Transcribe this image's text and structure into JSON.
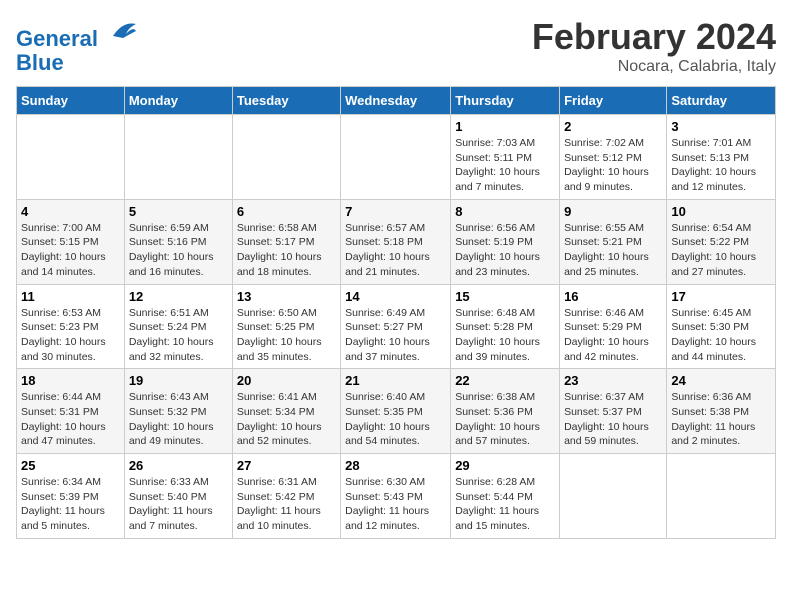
{
  "header": {
    "logo_line1": "General",
    "logo_line2": "Blue",
    "title": "February 2024",
    "subtitle": "Nocara, Calabria, Italy"
  },
  "days_of_week": [
    "Sunday",
    "Monday",
    "Tuesday",
    "Wednesday",
    "Thursday",
    "Friday",
    "Saturday"
  ],
  "weeks": [
    [
      {
        "num": "",
        "info": ""
      },
      {
        "num": "",
        "info": ""
      },
      {
        "num": "",
        "info": ""
      },
      {
        "num": "",
        "info": ""
      },
      {
        "num": "1",
        "info": "Sunrise: 7:03 AM\nSunset: 5:11 PM\nDaylight: 10 hours and 7 minutes."
      },
      {
        "num": "2",
        "info": "Sunrise: 7:02 AM\nSunset: 5:12 PM\nDaylight: 10 hours and 9 minutes."
      },
      {
        "num": "3",
        "info": "Sunrise: 7:01 AM\nSunset: 5:13 PM\nDaylight: 10 hours and 12 minutes."
      }
    ],
    [
      {
        "num": "4",
        "info": "Sunrise: 7:00 AM\nSunset: 5:15 PM\nDaylight: 10 hours and 14 minutes."
      },
      {
        "num": "5",
        "info": "Sunrise: 6:59 AM\nSunset: 5:16 PM\nDaylight: 10 hours and 16 minutes."
      },
      {
        "num": "6",
        "info": "Sunrise: 6:58 AM\nSunset: 5:17 PM\nDaylight: 10 hours and 18 minutes."
      },
      {
        "num": "7",
        "info": "Sunrise: 6:57 AM\nSunset: 5:18 PM\nDaylight: 10 hours and 21 minutes."
      },
      {
        "num": "8",
        "info": "Sunrise: 6:56 AM\nSunset: 5:19 PM\nDaylight: 10 hours and 23 minutes."
      },
      {
        "num": "9",
        "info": "Sunrise: 6:55 AM\nSunset: 5:21 PM\nDaylight: 10 hours and 25 minutes."
      },
      {
        "num": "10",
        "info": "Sunrise: 6:54 AM\nSunset: 5:22 PM\nDaylight: 10 hours and 27 minutes."
      }
    ],
    [
      {
        "num": "11",
        "info": "Sunrise: 6:53 AM\nSunset: 5:23 PM\nDaylight: 10 hours and 30 minutes."
      },
      {
        "num": "12",
        "info": "Sunrise: 6:51 AM\nSunset: 5:24 PM\nDaylight: 10 hours and 32 minutes."
      },
      {
        "num": "13",
        "info": "Sunrise: 6:50 AM\nSunset: 5:25 PM\nDaylight: 10 hours and 35 minutes."
      },
      {
        "num": "14",
        "info": "Sunrise: 6:49 AM\nSunset: 5:27 PM\nDaylight: 10 hours and 37 minutes."
      },
      {
        "num": "15",
        "info": "Sunrise: 6:48 AM\nSunset: 5:28 PM\nDaylight: 10 hours and 39 minutes."
      },
      {
        "num": "16",
        "info": "Sunrise: 6:46 AM\nSunset: 5:29 PM\nDaylight: 10 hours and 42 minutes."
      },
      {
        "num": "17",
        "info": "Sunrise: 6:45 AM\nSunset: 5:30 PM\nDaylight: 10 hours and 44 minutes."
      }
    ],
    [
      {
        "num": "18",
        "info": "Sunrise: 6:44 AM\nSunset: 5:31 PM\nDaylight: 10 hours and 47 minutes."
      },
      {
        "num": "19",
        "info": "Sunrise: 6:43 AM\nSunset: 5:32 PM\nDaylight: 10 hours and 49 minutes."
      },
      {
        "num": "20",
        "info": "Sunrise: 6:41 AM\nSunset: 5:34 PM\nDaylight: 10 hours and 52 minutes."
      },
      {
        "num": "21",
        "info": "Sunrise: 6:40 AM\nSunset: 5:35 PM\nDaylight: 10 hours and 54 minutes."
      },
      {
        "num": "22",
        "info": "Sunrise: 6:38 AM\nSunset: 5:36 PM\nDaylight: 10 hours and 57 minutes."
      },
      {
        "num": "23",
        "info": "Sunrise: 6:37 AM\nSunset: 5:37 PM\nDaylight: 10 hours and 59 minutes."
      },
      {
        "num": "24",
        "info": "Sunrise: 6:36 AM\nSunset: 5:38 PM\nDaylight: 11 hours and 2 minutes."
      }
    ],
    [
      {
        "num": "25",
        "info": "Sunrise: 6:34 AM\nSunset: 5:39 PM\nDaylight: 11 hours and 5 minutes."
      },
      {
        "num": "26",
        "info": "Sunrise: 6:33 AM\nSunset: 5:40 PM\nDaylight: 11 hours and 7 minutes."
      },
      {
        "num": "27",
        "info": "Sunrise: 6:31 AM\nSunset: 5:42 PM\nDaylight: 11 hours and 10 minutes."
      },
      {
        "num": "28",
        "info": "Sunrise: 6:30 AM\nSunset: 5:43 PM\nDaylight: 11 hours and 12 minutes."
      },
      {
        "num": "29",
        "info": "Sunrise: 6:28 AM\nSunset: 5:44 PM\nDaylight: 11 hours and 15 minutes."
      },
      {
        "num": "",
        "info": ""
      },
      {
        "num": "",
        "info": ""
      }
    ]
  ]
}
